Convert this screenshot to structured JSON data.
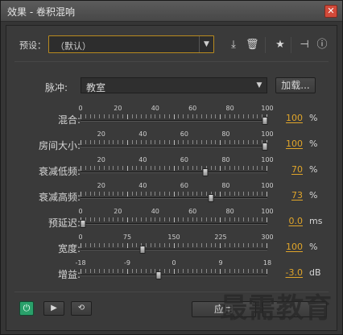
{
  "window": {
    "title": "效果 - 卷积混响",
    "close_glyph": "✕"
  },
  "preset": {
    "label": "预设：",
    "value": "（默认）",
    "arrow": "▼"
  },
  "toolbar": {
    "save_icon": "⤓",
    "delete_icon": "🗑",
    "favorite_icon": "★",
    "routing_icon": "⊣",
    "info_icon": "ⓘ"
  },
  "impulse": {
    "label": "脉冲:",
    "value": "教室",
    "arrow": "▼",
    "load_label": "加载..."
  },
  "params": [
    {
      "label": "混合:",
      "ticks": [
        "0",
        "20",
        "40",
        "60",
        "80",
        "100"
      ],
      "min": 0,
      "max": 100,
      "value": 100,
      "value_text": "100",
      "unit": "%"
    },
    {
      "label": "房间大小:",
      "ticks": [
        "20",
        "40",
        "60",
        "80",
        "100"
      ],
      "min": 10,
      "max": 100,
      "value": 100,
      "value_text": "100",
      "unit": "%"
    },
    {
      "label": "衰减低频:",
      "ticks": [
        "20",
        "40",
        "60",
        "80",
        "100"
      ],
      "min": 10,
      "max": 100,
      "value": 70,
      "value_text": "70",
      "unit": "%"
    },
    {
      "label": "衰减高频:",
      "ticks": [
        "20",
        "40",
        "60",
        "80",
        "100"
      ],
      "min": 10,
      "max": 100,
      "value": 73,
      "value_text": "73",
      "unit": "%"
    },
    {
      "label": "预延迟:",
      "ticks": [
        "0",
        "20",
        "40",
        "60",
        "80",
        "100"
      ],
      "min": 0,
      "max": 100,
      "value": 0,
      "value_text": "0.0",
      "unit": "ms"
    },
    {
      "label": "宽度:",
      "ticks": [
        "0",
        "75",
        "150",
        "225",
        "300"
      ],
      "min": 0,
      "max": 300,
      "value": 100,
      "value_text": "100",
      "unit": "%"
    },
    {
      "label": "增益:",
      "ticks": [
        "-18",
        "-9",
        "0",
        "9",
        "18"
      ],
      "min": -18,
      "max": 18,
      "value": -3,
      "value_text": "-3.0",
      "unit": "dB"
    }
  ],
  "footer": {
    "power_icon": "⏻",
    "play_icon": "▶",
    "loop_icon": "⟲",
    "apply_label": "应用",
    "watermark": "最需教育"
  },
  "colors": {
    "accent": "#e0a52a",
    "power_green": "#2aa06a",
    "preset_border": "#b88a1f"
  }
}
